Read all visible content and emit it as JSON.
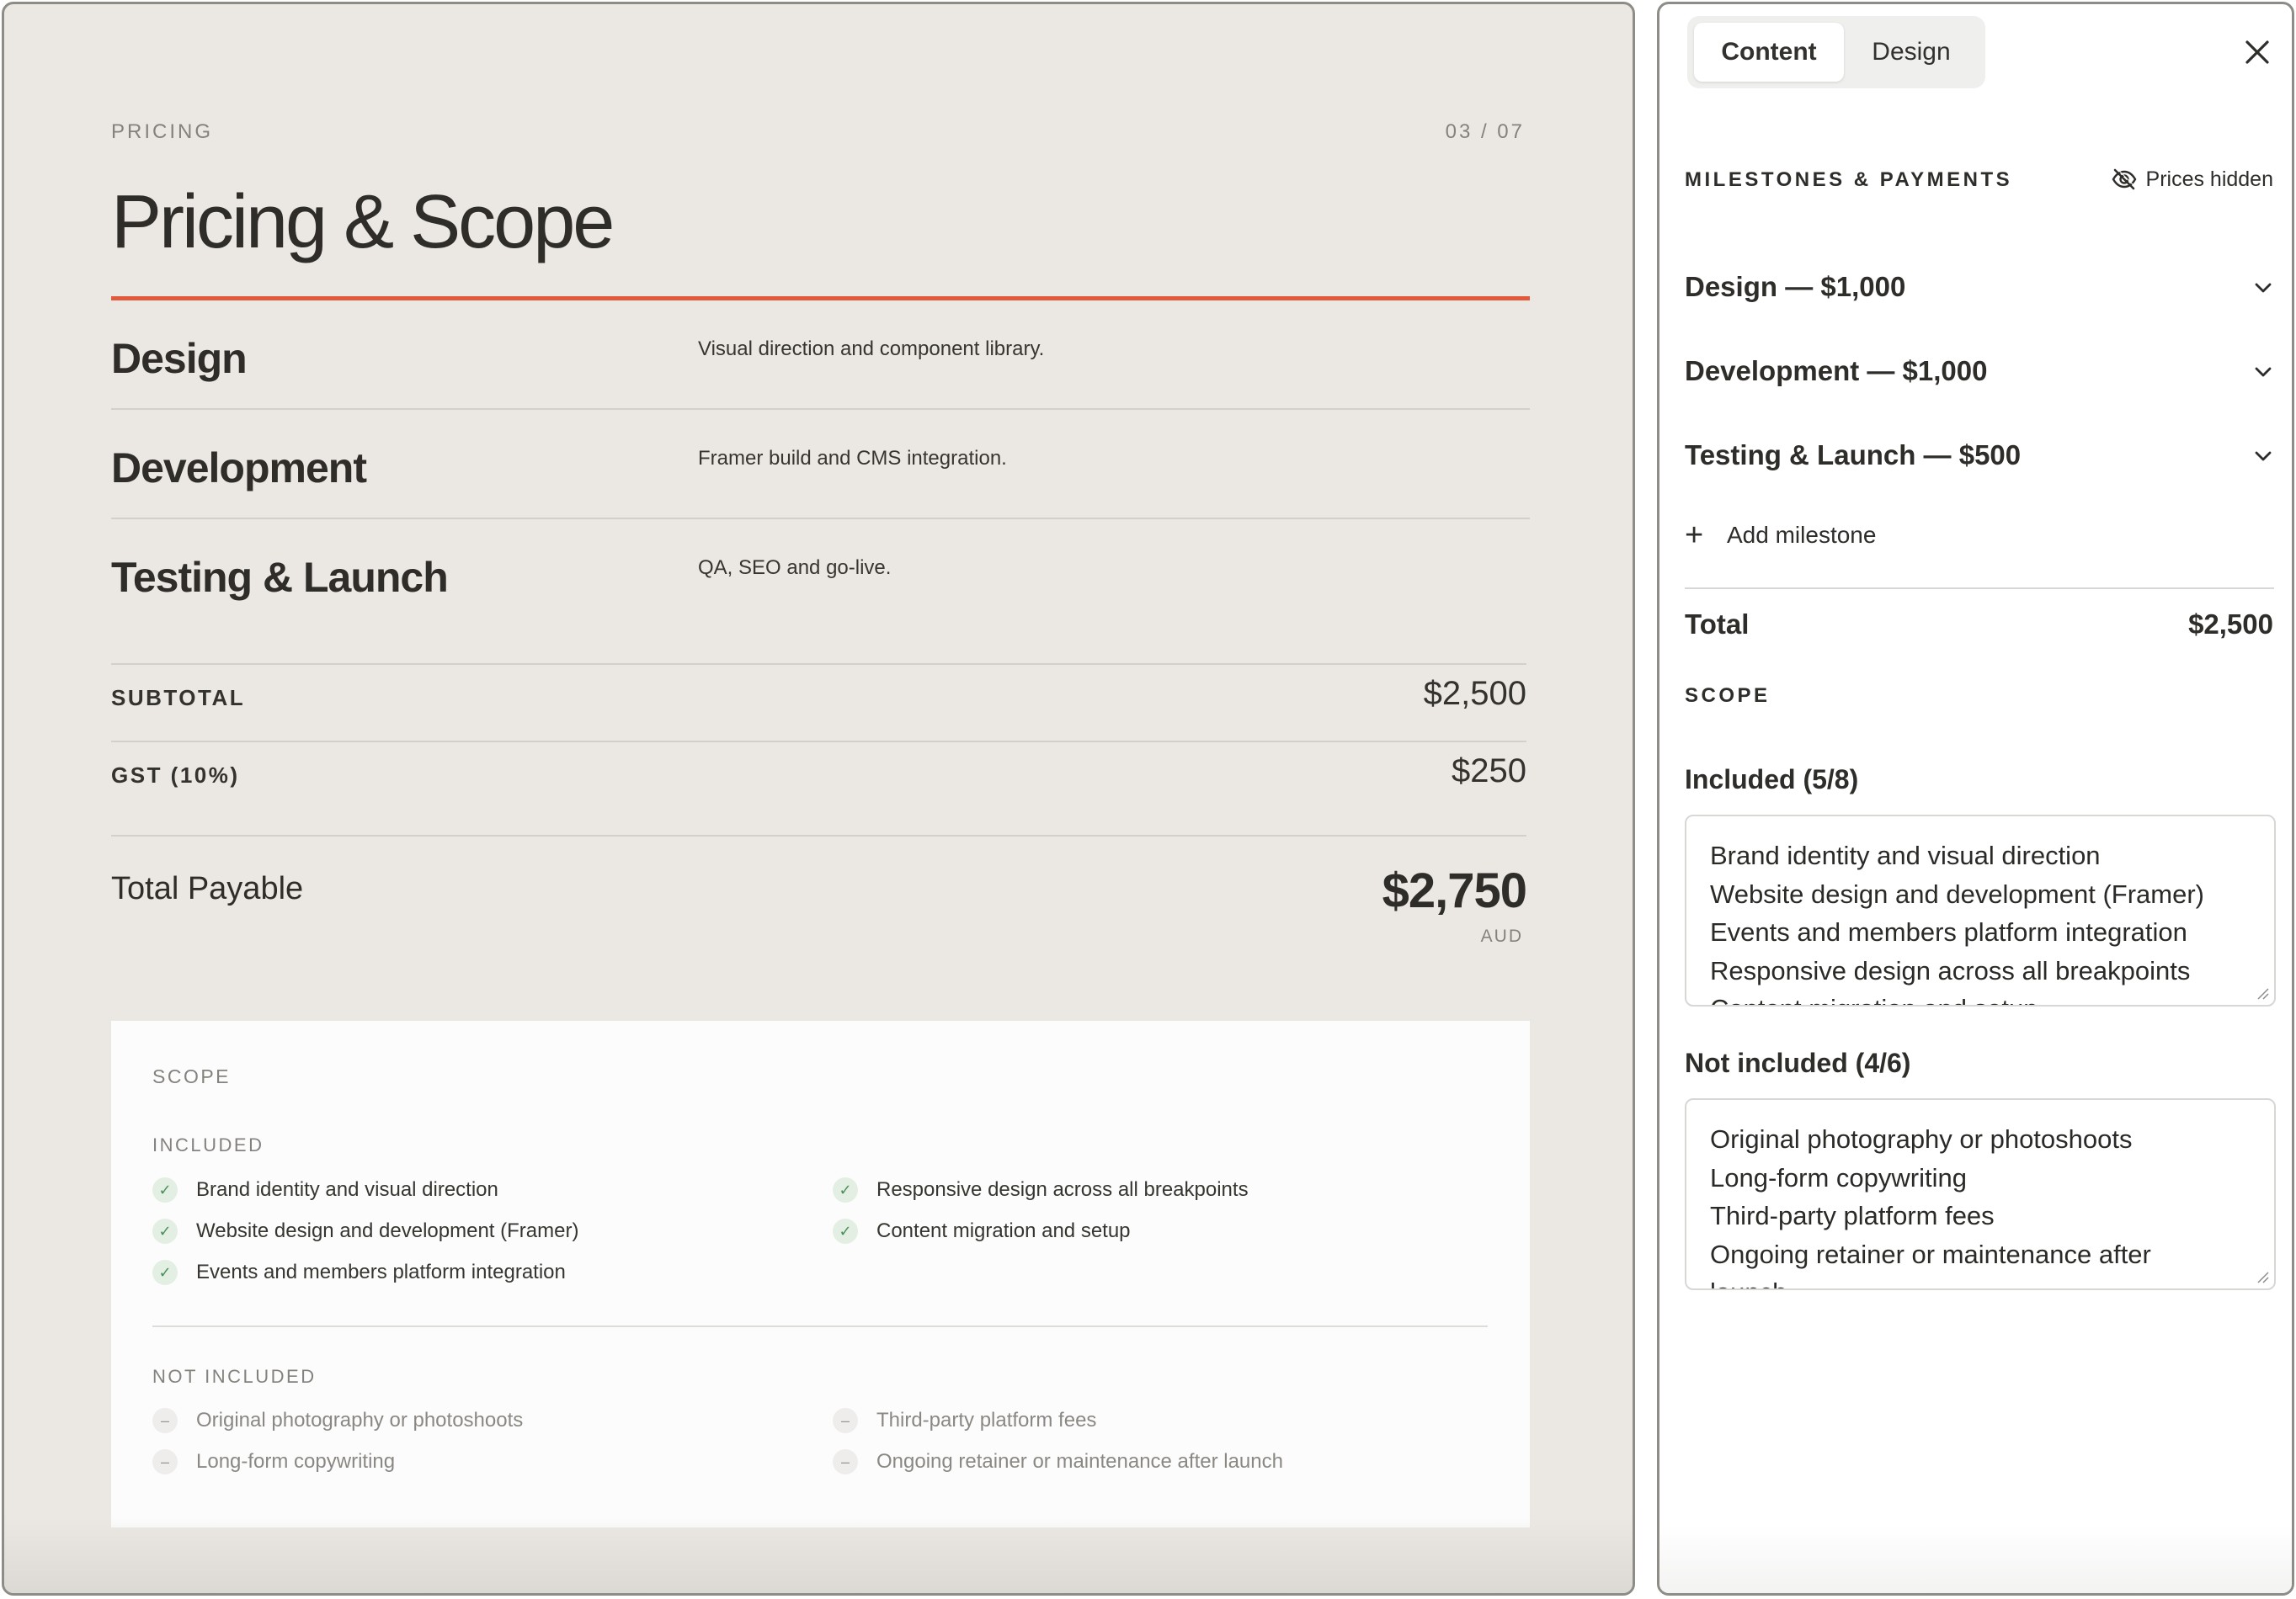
{
  "slide": {
    "eyebrow": "PRICING",
    "pager": "03 / 07",
    "title": "Pricing & Scope",
    "milestones": [
      {
        "name": "Design",
        "description": "Visual direction and component library."
      },
      {
        "name": "Development",
        "description": "Framer build and CMS integration."
      },
      {
        "name": "Testing & Launch",
        "description": "QA, SEO and go-live."
      }
    ],
    "subtotal_label": "SUBTOTAL",
    "subtotal_value": "$2,500",
    "gst_label": "GST (10%)",
    "gst_value": "$250",
    "total_label": "Total Payable",
    "total_value": "$2,750",
    "total_currency": "AUD",
    "scope": {
      "heading": "SCOPE",
      "included_heading": "INCLUDED",
      "included": [
        "Brand identity and visual direction",
        "Website design and development (Framer)",
        "Events and members platform integration",
        "Responsive design across all breakpoints",
        "Content migration and setup"
      ],
      "not_included_heading": "NOT INCLUDED",
      "not_included": [
        "Original photography or photoshoots",
        "Long-form copywriting",
        "Third-party platform fees",
        "Ongoing retainer or maintenance after launch"
      ]
    }
  },
  "editor": {
    "tabs": [
      {
        "label": "Content"
      },
      {
        "label": "Design"
      }
    ],
    "active_tab": "Content",
    "milestones_section": "MILESTONES & PAYMENTS",
    "prices_toggle": "Prices hidden",
    "accordions": [
      {
        "label": "Design — $1,000"
      },
      {
        "label": "Development — $1,000"
      },
      {
        "label": "Testing & Launch — $500"
      }
    ],
    "add_milestone": "Add milestone",
    "total_label": "Total",
    "total_value": "$2,500",
    "scope_section": "SCOPE",
    "included_label": "Included (5/8)",
    "included_lines": [
      "Brand identity and visual direction",
      "Website design and development (Framer)",
      "Events and members platform integration",
      "Responsive design across all breakpoints",
      "Content migration and setup"
    ],
    "not_included_label": "Not included (4/6)",
    "not_included_lines": [
      "Original photography or photoshoots",
      "Long-form copywriting",
      "Third-party platform fees",
      "Ongoing retainer or maintenance after",
      "launch"
    ]
  },
  "colors": {
    "accent_rule": "#e2593b",
    "slide_background": "#ebe8e4",
    "check_green": "#4a8f57"
  },
  "icons": [
    "check-icon",
    "dash-icon",
    "close-icon",
    "eye-off-icon",
    "chevron-down-icon",
    "plus-icon"
  ]
}
